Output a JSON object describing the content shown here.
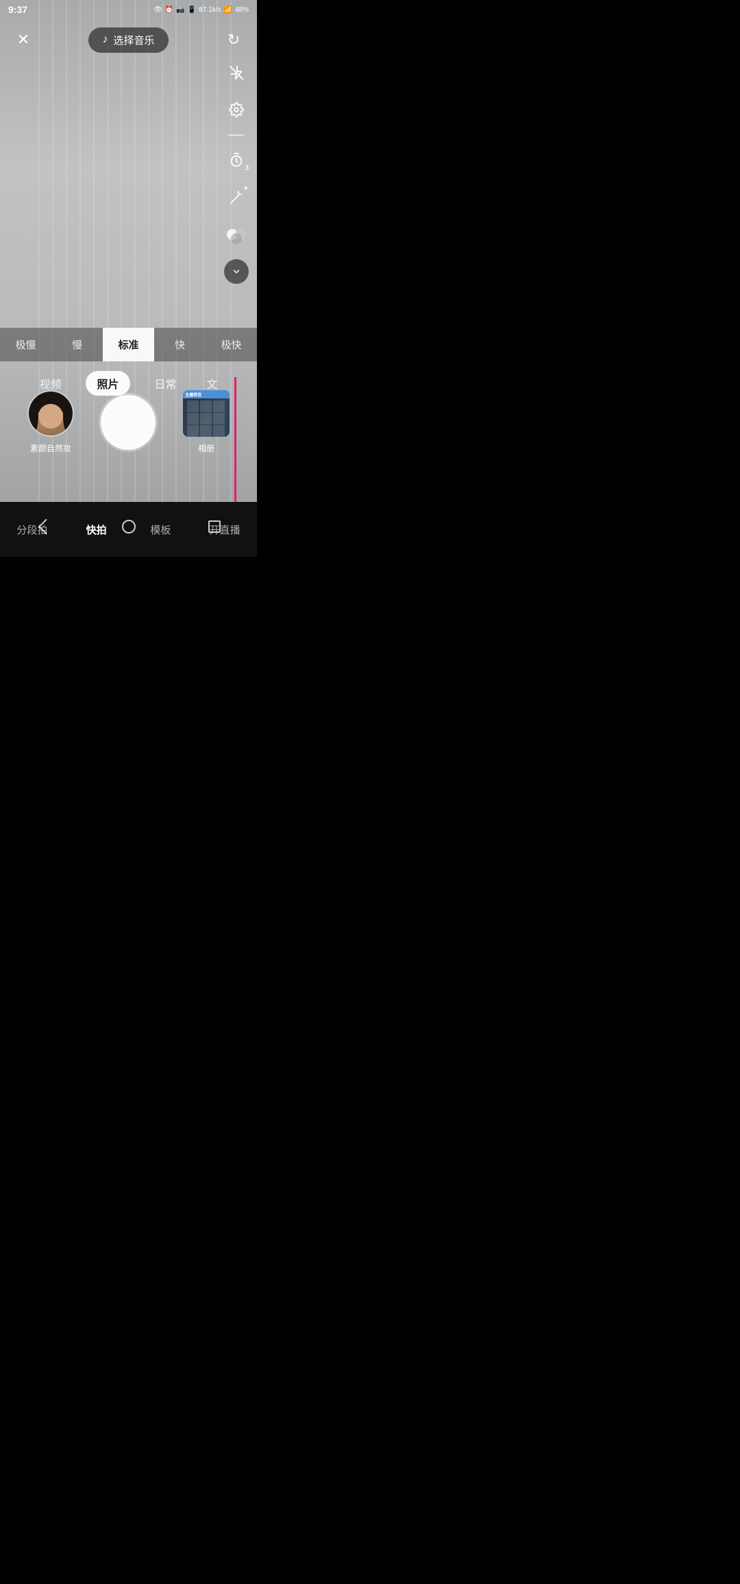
{
  "statusBar": {
    "time": "9:37",
    "battery": "48%"
  },
  "topBar": {
    "closeLabel": "×",
    "musicLabel": "选择音乐",
    "refreshLabel": "↻"
  },
  "sidebarIcons": {
    "flash": "flash-icon",
    "settings": "settings-icon",
    "timer": "timer-icon",
    "timerBadge": "3",
    "wand": "wand-icon",
    "colors": "colors-icon",
    "chevron": "chevron-down-icon"
  },
  "speedSelector": {
    "items": [
      "极慢",
      "慢",
      "标准",
      "快",
      "极快"
    ],
    "activeIndex": 2
  },
  "modeSelector": {
    "items": [
      "视频",
      "照片",
      "日常",
      "文"
    ],
    "activeIndex": 1
  },
  "filterLabel": "素颜自然妆",
  "albumLabel": "相册",
  "bottomNav": {
    "items": [
      "分段拍",
      "快拍",
      "模板",
      "开直播"
    ],
    "activeIndex": 1
  }
}
